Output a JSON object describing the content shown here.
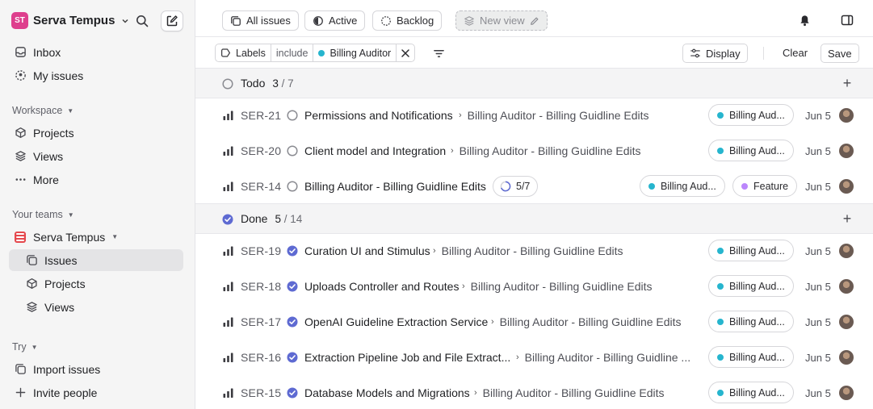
{
  "workspace": {
    "initials": "ST",
    "name": "Serva Tempus"
  },
  "sidebar": {
    "inbox": "Inbox",
    "my_issues": "My issues",
    "workspace_section": "Workspace",
    "projects": "Projects",
    "views": "Views",
    "more": "More",
    "teams_section": "Your teams",
    "team_name": "Serva Tempus",
    "team_issues": "Issues",
    "team_projects": "Projects",
    "team_views": "Views",
    "try_section": "Try",
    "import_issues": "Import issues",
    "invite_people": "Invite people"
  },
  "topbar": {
    "all_issues": "All issues",
    "active": "Active",
    "backlog": "Backlog",
    "new_view": "New view"
  },
  "filter": {
    "field": "Labels",
    "operator": "include",
    "value": "Billing Auditor",
    "display": "Display",
    "clear": "Clear",
    "save": "Save"
  },
  "groups": [
    {
      "name": "Todo",
      "count": "3",
      "total": "/ 7"
    },
    {
      "name": "Done",
      "count": "5",
      "total": "/ 14"
    }
  ],
  "colors": {
    "label_billing": "#26b5ce",
    "label_feature": "#bb87fc",
    "done": "#5e6ad2",
    "workspace_avatar": "#de3f8d",
    "team_icon": "#e5484d"
  },
  "todo_issues": [
    {
      "id": "SER-21",
      "title": "Permissions and Notifications",
      "parent": "Billing Auditor - Billing Guidline Edits",
      "label": "Billing Aud...",
      "date": "Jun 5"
    },
    {
      "id": "SER-20",
      "title": "Client model and Integration",
      "parent": "Billing Auditor - Billing Guidline Edits",
      "label": "Billing Aud...",
      "date": "Jun 5"
    },
    {
      "id": "SER-14",
      "title": "Billing Auditor - Billing Guidline Edits",
      "progress": "5/7",
      "label": "Billing Aud...",
      "label2": "Feature",
      "date": "Jun 5"
    }
  ],
  "done_issues": [
    {
      "id": "SER-19",
      "title": "Curation UI and Stimulus",
      "parent": "Billing Auditor - Billing Guidline Edits",
      "label": "Billing Aud...",
      "date": "Jun 5"
    },
    {
      "id": "SER-18",
      "title": "Uploads Controller and Routes",
      "parent": "Billing Auditor - Billing Guidline Edits",
      "label": "Billing Aud...",
      "date": "Jun 5"
    },
    {
      "id": "SER-17",
      "title": "OpenAI Guideline Extraction Service",
      "parent": "Billing Auditor - Billing Guidline Edits",
      "label": "Billing Aud...",
      "date": "Jun 5"
    },
    {
      "id": "SER-16",
      "title": "Extraction Pipeline Job and File Extract...",
      "parent": "Billing Auditor - Billing Guidline ...",
      "label": "Billing Aud...",
      "date": "Jun 5"
    },
    {
      "id": "SER-15",
      "title": "Database Models and Migrations",
      "parent": "Billing Auditor - Billing Guidline Edits",
      "label": "Billing Aud...",
      "date": "Jun 5"
    }
  ]
}
